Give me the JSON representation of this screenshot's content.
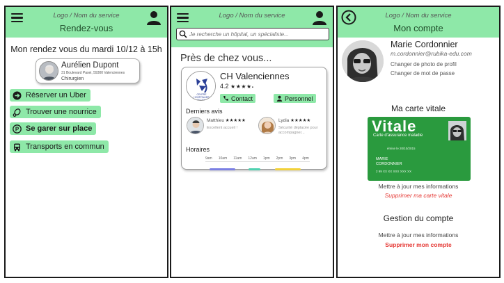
{
  "colors": {
    "accent": "#8ee8a8",
    "danger": "#e53935",
    "vitale": "#2a9a3e",
    "timeline": [
      "#7b7fe3",
      "#4fd1b0",
      "#f2d13a"
    ]
  },
  "screen1": {
    "logo": "Logo / Nom du service",
    "title": "Rendez-vous",
    "appointment": "Mon rendez vous du mardi 10/12 à 15h",
    "doctor": {
      "name": "Aurélien Dupont",
      "address": "31 Boulevard Pasei, 59300 Valenciennes",
      "role": "Chirurgien"
    },
    "actions": [
      {
        "label": "Réserver un Uber",
        "icon": "uber-icon"
      },
      {
        "label": "Trouver une nourrice",
        "icon": "pacifier-icon"
      },
      {
        "label": "Se garer sur place",
        "icon": "parking-icon"
      },
      {
        "label": "Transports en commun",
        "icon": "bus-icon"
      }
    ]
  },
  "screen2": {
    "logo": "Logo / Nom du service",
    "search_placeholder": "Je recherche un hôpital, un spécialiste...",
    "near_title": "Près de chez vous...",
    "hospital": {
      "name": "CH Valenciennes",
      "rating": "4.2",
      "stars": "★★★★",
      "logo_text": "CENTRE HOSPITALIER VALENCIENNES",
      "contact": "Contact",
      "staff": "Personnel"
    },
    "reviews_title": "Derniers avis",
    "reviews": [
      {
        "name": "Matthieu",
        "stars": "★★★★★",
        "text": "Excellent accueil !"
      },
      {
        "name": "Lydia",
        "stars": "★★★★★",
        "text": "Sécurité déplacée pour accompagner..."
      }
    ],
    "hours_title": "Horaires",
    "hours": [
      "9am",
      "10am",
      "11am",
      "12am",
      "1pm",
      "2pm",
      "3pm",
      "4pm"
    ]
  },
  "screen3": {
    "logo": "Logo / Nom du service",
    "title": "Mon compte",
    "name": "Marie Cordonnier",
    "email": "m.cordonnier@rubika-edu.com",
    "change_photo": "Changer de photo de profil",
    "change_password": "Changer de mot de passe",
    "card_title": "Ma carte vitale",
    "vitale": {
      "word": "Vitale",
      "subtitle": "Carte d'assurance maladie",
      "issued": "émise le 20/10/2015",
      "holder_first": "MARIE",
      "holder_last": "CORDONNIER",
      "number": "2 99 XX XX XXX XXX XX"
    },
    "update_card": "Mettre à jour mes informations",
    "delete_card": "Supprimer ma carte vitale",
    "gestion_title": "Gestion du compte",
    "update_account": "Mettre à jour mes informations",
    "delete_account": "Supprimer mon compte"
  }
}
